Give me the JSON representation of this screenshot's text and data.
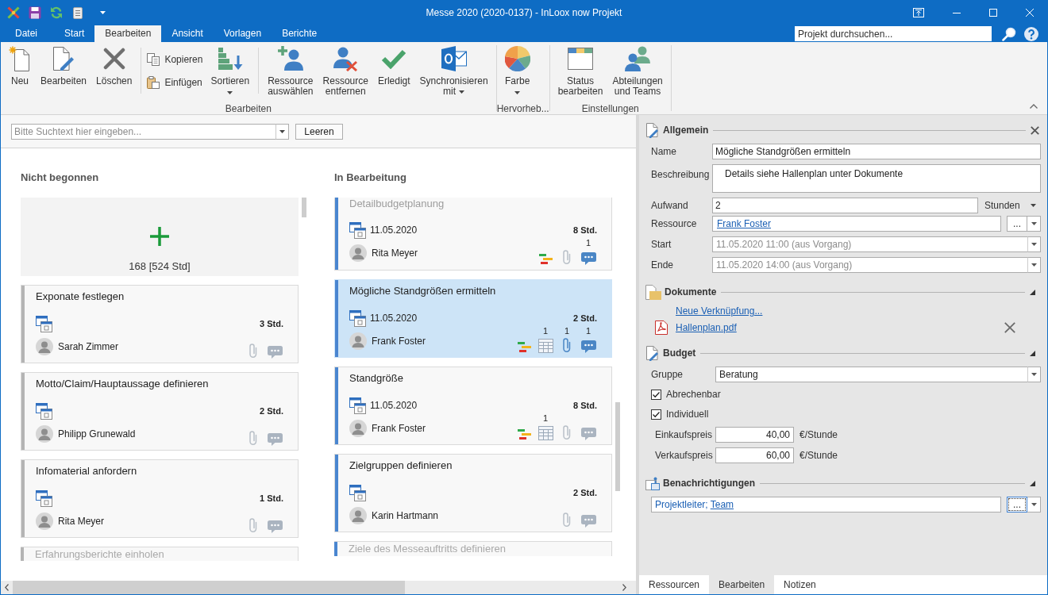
{
  "window": {
    "title": "Messe 2020 (2020-0137) - InLoox now Projekt"
  },
  "ribbon_tabs": [
    {
      "label": "Datei",
      "selected": false
    },
    {
      "label": "Start",
      "selected": false
    },
    {
      "label": "Bearbeiten",
      "selected": true
    },
    {
      "label": "Ansicht",
      "selected": false
    },
    {
      "label": "Vorlagen",
      "selected": false
    },
    {
      "label": "Berichte",
      "selected": false
    }
  ],
  "project_search": {
    "placeholder": "Projekt durchsuchen..."
  },
  "ribbon_groups": [
    {
      "label": "Bearbeiten",
      "items": [
        {
          "kind": "large",
          "label": "Neu",
          "menu": false
        },
        {
          "kind": "large",
          "label": "Bearbeiten",
          "menu": false
        },
        {
          "kind": "large",
          "label": "Löschen",
          "menu": false
        },
        {
          "kind": "separator"
        },
        {
          "kind": "stack",
          "items": [
            {
              "label": "Kopieren"
            },
            {
              "label": "Einfügen"
            }
          ]
        },
        {
          "kind": "large",
          "label": "Sortieren",
          "menu": true
        },
        {
          "kind": "separator"
        },
        {
          "kind": "large",
          "label": "Ressource\nauswählen",
          "menu": false
        },
        {
          "kind": "large",
          "label": "Ressource\nentfernen",
          "menu": false
        },
        {
          "kind": "large",
          "label": "Erledigt",
          "menu": false
        },
        {
          "kind": "large",
          "label": "Synchronisieren\nmit",
          "menu": true
        }
      ]
    },
    {
      "label": "Hervorheb...",
      "items": [
        {
          "kind": "large",
          "label": "Farbe",
          "menu": true
        }
      ]
    },
    {
      "label": "Einstellungen",
      "items": [
        {
          "kind": "large",
          "label": "Status\nbearbeiten",
          "menu": false
        },
        {
          "kind": "large",
          "label": "Abteilungen\nund Teams",
          "menu": false
        }
      ]
    }
  ],
  "board_search": {
    "placeholder": "Bitte Suchtext hier eingeben...",
    "button": "Leeren"
  },
  "columns": [
    {
      "title": "Nicht begonnen",
      "color": "#b4b4b4",
      "add_card": {
        "summary": "168 [524 Std]"
      },
      "cards": [
        {
          "kind": "full",
          "title": "Exponate festlegen",
          "hours": "3 Std.",
          "assignee": "Sarah Zimmer",
          "selected": false,
          "indicators": [
            {
              "kind": "attachment",
              "active": false
            },
            {
              "kind": "comment",
              "active": false
            }
          ]
        },
        {
          "kind": "full",
          "title": "Motto/Claim/Hauptaussage definieren",
          "hours": "2 Std.",
          "assignee": "Philipp Grunewald",
          "selected": false,
          "indicators": [
            {
              "kind": "attachment",
              "active": false
            },
            {
              "kind": "comment",
              "active": false
            }
          ]
        },
        {
          "kind": "full",
          "title": "Infomaterial anfordern",
          "hours": "1 Std.",
          "assignee": "Rita Meyer",
          "selected": false,
          "indicators": [
            {
              "kind": "attachment",
              "active": false
            },
            {
              "kind": "comment",
              "active": false
            }
          ]
        },
        {
          "kind": "head",
          "title": "Erfahrungsberichte einholen",
          "selected": false
        }
      ]
    },
    {
      "title": "In Bearbeitung",
      "color": "#4a86d0",
      "cards": [
        {
          "kind": "tail",
          "title": "Detailbudgetplanung",
          "date": "11.05.2020",
          "hours": "8 Std.",
          "assignee": "Rita Meyer",
          "selected": false,
          "indicators": [
            {
              "kind": "gantt"
            },
            {
              "kind": "attachment",
              "active": false
            },
            {
              "kind": "comment",
              "active": true,
              "count": "1"
            }
          ]
        },
        {
          "kind": "full",
          "title": "Mögliche Standgrößen ermitteln",
          "date": "11.05.2020",
          "hours": "2 Std.",
          "assignee": "Frank Foster",
          "selected": true,
          "indicators": [
            {
              "kind": "gantt"
            },
            {
              "kind": "table",
              "count": "1"
            },
            {
              "kind": "attachment",
              "active": true,
              "count": "1"
            },
            {
              "kind": "comment",
              "active": true,
              "count": "1"
            }
          ]
        },
        {
          "kind": "full",
          "title": "Standgröße",
          "date": "11.05.2020",
          "hours": "8 Std.",
          "assignee": "Frank Foster",
          "selected": false,
          "indicators": [
            {
              "kind": "gantt"
            },
            {
              "kind": "table",
              "count": "1"
            },
            {
              "kind": "attachment",
              "active": false
            },
            {
              "kind": "comment",
              "active": false
            }
          ]
        },
        {
          "kind": "full",
          "title": "Zielgruppen definieren",
          "hours": "2 Std.",
          "assignee": "Karin Hartmann",
          "selected": false,
          "indicators": [
            {
              "kind": "attachment",
              "active": false
            },
            {
              "kind": "comment",
              "active": false
            }
          ]
        },
        {
          "kind": "head",
          "title": "Ziele des Messeauftritts definieren",
          "selected": false
        }
      ]
    }
  ],
  "details": {
    "general": {
      "title": "Allgemein",
      "fields": [
        {
          "kind": "text",
          "label": "Name",
          "value": "Mögliche Standgrößen ermitteln",
          "disabled": false
        },
        {
          "kind": "textarea",
          "label": "Beschreibung",
          "value": "Details siehe Hallenplan unter Dokumente",
          "disabled": false
        },
        {
          "kind": "number_unit",
          "label": "Aufwand",
          "value": "2",
          "unit": "Stunden",
          "disabled": false
        },
        {
          "kind": "link_picker",
          "label": "Ressource",
          "value": "Frank Foster",
          "button": "...",
          "disabled": false
        },
        {
          "kind": "date",
          "label": "Start",
          "value": "11.05.2020 11:00 (aus Vorgang)",
          "disabled": true
        },
        {
          "kind": "date",
          "label": "Ende",
          "value": "11.05.2020 14:00 (aus Vorgang)",
          "disabled": true
        }
      ]
    },
    "documents": {
      "title": "Dokumente",
      "expanded": true,
      "new_link": "Neue Verknüpfung...",
      "files": [
        {
          "name": "Hallenplan.pdf"
        }
      ]
    },
    "budget": {
      "title": "Budget",
      "expanded": true,
      "group": {
        "label": "Gruppe",
        "value": "Beratung"
      },
      "options": [
        {
          "label": "Abrechenbar",
          "checked": true
        },
        {
          "label": "Individuell",
          "checked": true
        }
      ],
      "prices": [
        {
          "label": "Einkaufspreis",
          "value": "40,00",
          "unit": "€/Stunde"
        },
        {
          "label": "Verkaufspreis",
          "value": "60,00",
          "unit": "€/Stunde"
        }
      ]
    },
    "notifications": {
      "title": "Benachrichtigungen",
      "expanded": true,
      "recipients": [
        {
          "text": "Projektleiter;",
          "underlined": false
        },
        {
          "text": "Team",
          "underlined": true
        }
      ],
      "button": "...",
      "focused": true
    },
    "tabs": [
      {
        "label": "Ressourcen",
        "selected": false
      },
      {
        "label": "Bearbeiten",
        "selected": true
      },
      {
        "label": "Notizen",
        "selected": false
      }
    ]
  }
}
